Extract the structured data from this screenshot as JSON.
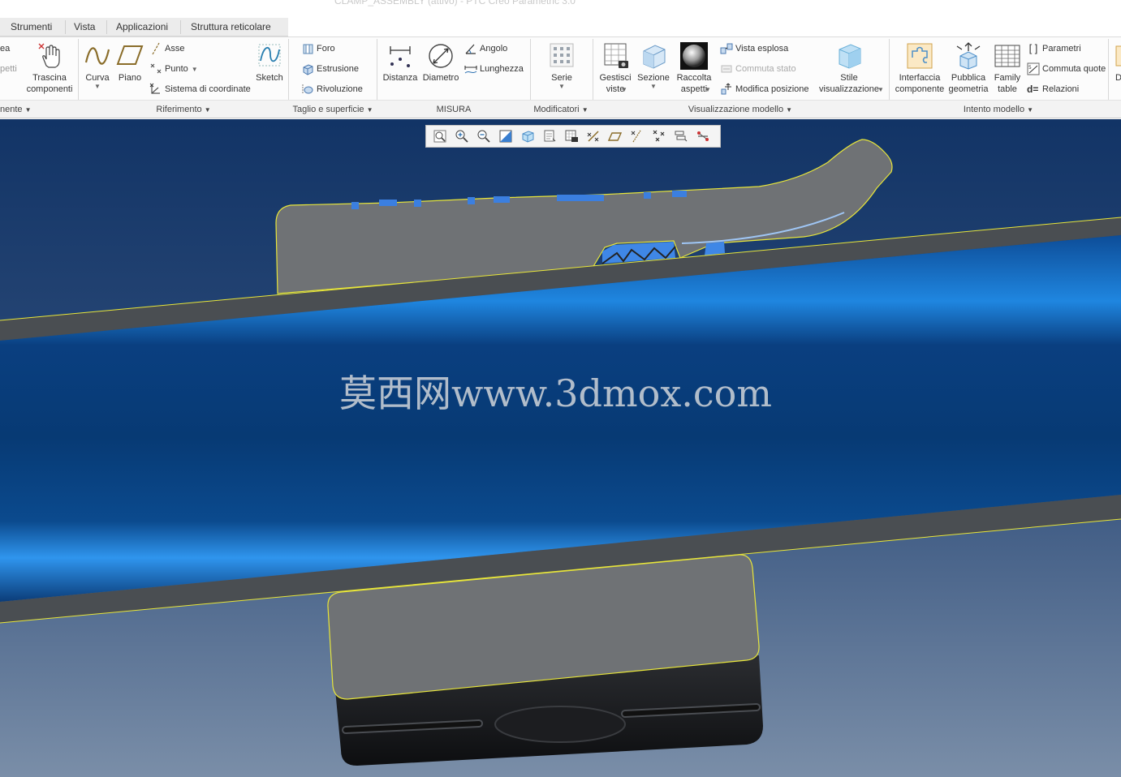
{
  "window": {
    "title": "CLAMP_ASSEMBLY (attivo) - PTC Creo Parametric 3.0"
  },
  "menu_tabs": [
    "Strumenti",
    "Vista",
    "Applicazioni",
    "Struttura reticolare"
  ],
  "ribbon": {
    "clipped_left_top": "ea",
    "clipped_left_mid": "petti",
    "trascina_label": "Trascina\ncomponenti",
    "curva_label": "Curva",
    "piano_label": "Piano",
    "asse_label": "Asse",
    "punto_label": "Punto",
    "sistema_label": "Sistema di coordinate",
    "sketch_label": "Sketch",
    "foro_label": "Foro",
    "estrusione_label": "Estrusione",
    "rivoluzione_label": "Rivoluzione",
    "distanza_label": "Distanza",
    "diametro_label": "Diametro",
    "angolo_label": "Angolo",
    "lunghezza_label": "Lunghezza",
    "serie_label": "Serie",
    "gestisci_label": "Gestisci\nviste",
    "sezione_label": "Sezione",
    "raccolta_label": "Raccolta\naspetti",
    "vista_esplosa_label": "Vista esplosa",
    "commuta_stato_label": "Commuta stato",
    "modifica_posizione_label": "Modifica posizione",
    "stile_label": "Stile\nvisualizzazione",
    "interfaccia_label": "Interfaccia\ncomponente",
    "pubblica_label": "Pubblica\ngeometria",
    "family_label": "Family\ntable",
    "parametri_label": "Parametri",
    "commuta_quote_label": "Commuta quote",
    "relazioni_label": "Relazioni",
    "clipped_right": "D"
  },
  "groups": {
    "componente": "nente",
    "riferimento": "Riferimento",
    "taglio": "Taglio e superficie",
    "misura": "MISURA",
    "modificatori": "Modificatori",
    "visualizzazione": "Visualizzazione modello",
    "intento": "Intento modello"
  },
  "watermark": "莫西网www.3dmox.com",
  "icons": {
    "view_toolbar": [
      "refit-icon",
      "zoom-in-icon",
      "zoom-out-icon",
      "repaint-icon",
      "display-style-icon",
      "saved-views-icon",
      "named-view-icon",
      "plane-display-icon",
      "axis-display-icon",
      "point-display-icon",
      "csys-display-icon",
      "spin-center-icon",
      "annotation-display-icon"
    ]
  },
  "colors": {
    "viewport_top": "#123466",
    "beam_blue": "#0a4a93",
    "part_gray": "#6f7275",
    "edge_yellow": "#e8e63a"
  }
}
